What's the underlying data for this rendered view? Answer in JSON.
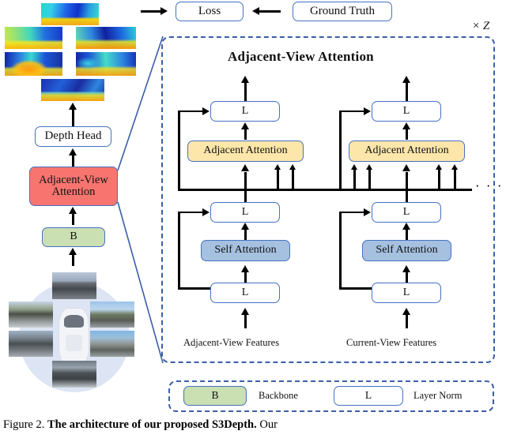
{
  "figure": {
    "caption_prefix": "Figure 2.",
    "caption_bold": "The architecture of our proposed S3Depth.",
    "caption_suffix": "Our"
  },
  "pipeline": {
    "depth_outputs_label": "predicted-depth-maps",
    "input_label": "multi-camera-surround-view",
    "nodes": [
      {
        "id": "backbone",
        "label": "B",
        "color": "#cadfb2"
      },
      {
        "id": "adjacent_view_attention",
        "label": "Adjacent-View\nAttention",
        "line1": "Adjacent-View",
        "line2": "Attention",
        "color": "#f8756f"
      },
      {
        "id": "depth_head",
        "label": "Depth Head",
        "color": "#ffffff"
      }
    ],
    "loss": "Loss",
    "ground_truth": "Ground Truth"
  },
  "panel": {
    "title": "Adjacent-View Attention",
    "repeat_label": "× Z",
    "ellipsis": "· · ·",
    "columns": [
      {
        "id": "adjacent_view",
        "footer": "Adjacent-View Features",
        "blocks": [
          {
            "id": "norm_bottom",
            "label": "L"
          },
          {
            "id": "self_attention",
            "label": "Self Attention",
            "color": "#a6c0e0"
          },
          {
            "id": "norm_middle",
            "label": "L"
          },
          {
            "id": "adjacent_attention",
            "label": "Adjacent Attention",
            "color": "#fce6aa"
          },
          {
            "id": "norm_top",
            "label": "L"
          }
        ]
      },
      {
        "id": "current_view",
        "footer": "Current-View Features",
        "blocks": [
          {
            "id": "norm_bottom",
            "label": "L"
          },
          {
            "id": "self_attention",
            "label": "Self Attention",
            "color": "#a6c0e0"
          },
          {
            "id": "norm_middle",
            "label": "L"
          },
          {
            "id": "adjacent_attention",
            "label": "Adjacent Attention",
            "color": "#fce6aa"
          },
          {
            "id": "norm_top",
            "label": "L"
          }
        ]
      }
    ]
  },
  "legend": {
    "items": [
      {
        "id": "backbone",
        "chip": "B",
        "label": "Backbone",
        "color": "#cadfb2"
      },
      {
        "id": "layer_norm",
        "chip": "L",
        "label": "Layer Norm",
        "color": "#ffffff"
      }
    ]
  },
  "colors": {
    "box_border": "#4472c4",
    "dashed_border": "#3b5ea8",
    "red": "#f8756f",
    "green": "#cadfb2",
    "yellow": "#fce6aa",
    "blue": "#a6c0e0",
    "arrow": "#000000"
  }
}
